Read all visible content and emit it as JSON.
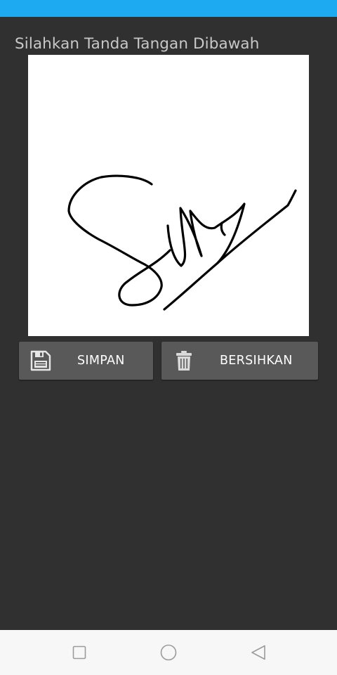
{
  "status_bar": {
    "color": "#1eaaf1"
  },
  "screen": {
    "instruction": "Silahkan Tanda Tangan Dibawah",
    "signature_pad": {
      "background": "#ffffff",
      "ink": "#000000"
    },
    "buttons": {
      "save": {
        "label": "SIMPAN",
        "icon": "floppy-disk-icon"
      },
      "clear": {
        "label": "BERSIHKAN",
        "icon": "trash-can-icon"
      }
    }
  },
  "nav_bar": {
    "recents_icon": "square-icon",
    "home_icon": "circle-icon",
    "back_icon": "triangle-back-icon"
  }
}
